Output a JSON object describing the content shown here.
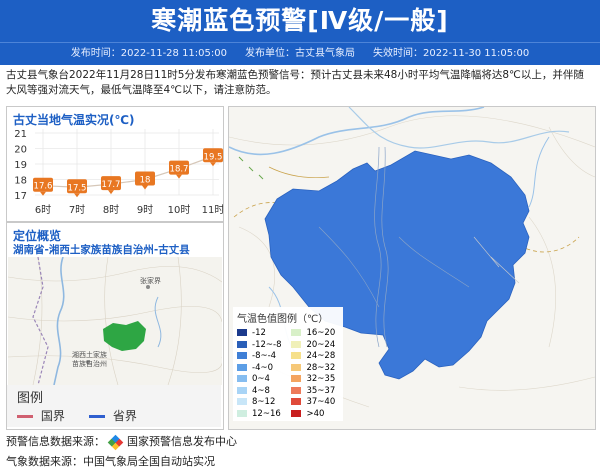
{
  "header": {
    "title": "寒潮蓝色预警[Ⅳ级/一般]",
    "publish_time": "发布时间：2022-11-28 11:05:00",
    "publisher": "发布单位：古丈县气象局",
    "expire_time": "失效时间：2022-11-30 11:05:00"
  },
  "description": "古丈县气象台2022年11月28日11时5分发布寒潮蓝色预警信号：预计古丈县未来48小时平均气温降幅将达8℃以上，并伴随大风等强对流天气，最低气温降至4℃以下，请注意防范。",
  "temp_panel": {
    "title": "古丈当地气温实况(℃)"
  },
  "chart_data": {
    "type": "line",
    "title": "古丈当地气温实况(℃)",
    "categories": [
      "6时",
      "7时",
      "8时",
      "9时",
      "10时",
      "11时"
    ],
    "values": [
      17.6,
      17.5,
      17.7,
      18,
      18.7,
      19.5
    ],
    "value_labels": [
      "17.6",
      "17.5",
      "17.7",
      "18",
      "18.7",
      "19.5"
    ],
    "yticks": [
      17,
      18,
      19,
      20,
      21
    ],
    "ylim": [
      17,
      21
    ],
    "grid": true,
    "color": "#e87722"
  },
  "location": {
    "title": "定位概览",
    "region": "湖南省-湘西土家族苗族自治州-古丈县",
    "map_labels": [
      "湘西土家族",
      "苗族自治州",
      "张家界"
    ]
  },
  "boundary_legend": {
    "title": "图例",
    "items": [
      {
        "label": "国界",
        "color": "#d06070"
      },
      {
        "label": "省界",
        "color": "#2f5fcf"
      }
    ]
  },
  "temp_legend": {
    "title": "气温色值图例（℃）",
    "items": [
      {
        "label": "-12",
        "color": "#1b3a8c"
      },
      {
        "label": "16~20",
        "color": "#d8f0c8"
      },
      {
        "label": "-12~-8",
        "color": "#2a5fb8"
      },
      {
        "label": "20~24",
        "color": "#f0f0b8"
      },
      {
        "label": "-8~-4",
        "color": "#3f7fd6"
      },
      {
        "label": "24~28",
        "color": "#f6e08a"
      },
      {
        "label": "-4~0",
        "color": "#5c9ee6"
      },
      {
        "label": "28~32",
        "color": "#f6c878"
      },
      {
        "label": "0~4",
        "color": "#86bdf0"
      },
      {
        "label": "32~35",
        "color": "#f4a460"
      },
      {
        "label": "4~8",
        "color": "#a8d4f6"
      },
      {
        "label": "35~37",
        "color": "#ee7a5a"
      },
      {
        "label": "8~12",
        "color": "#c8e6f8"
      },
      {
        "label": "37~40",
        "color": "#e04a3a"
      },
      {
        "label": "12~16",
        "color": "#cfeee0"
      },
      {
        "label": ">40",
        "color": "#c81e1e"
      }
    ]
  },
  "footer": {
    "source_label": "预警信息数据来源：",
    "source_value": "国家预警信息发布中心",
    "weather_source": "气象数据来源：中国气象局全国自动站实况"
  }
}
